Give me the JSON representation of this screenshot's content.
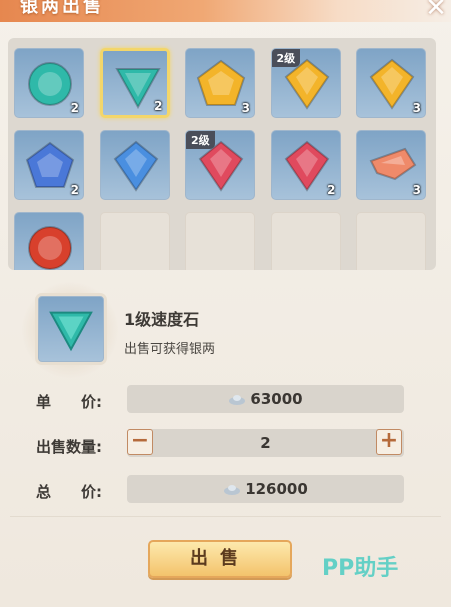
{
  "window": {
    "title": "银两出售",
    "close_icon": "close-icon"
  },
  "inventory": {
    "slots": [
      {
        "gem": "round-teal-gem",
        "color": "#2fb9a9",
        "count": "2",
        "level": ""
      },
      {
        "gem": "triangle-teal-gem",
        "color": "#2fb9a9",
        "count": "2",
        "level": "",
        "selected": true
      },
      {
        "gem": "pentagon-yellow-gem",
        "color": "#f3b42a",
        "count": "3",
        "level": ""
      },
      {
        "gem": "diamond-yellow-gem",
        "color": "#f3b42a",
        "count": "",
        "level": "2级"
      },
      {
        "gem": "diamond-yellow-gem",
        "color": "#f3b42a",
        "count": "3",
        "level": ""
      },
      {
        "gem": "pentagon-blue-gem",
        "color": "#4a78d8",
        "count": "2",
        "level": ""
      },
      {
        "gem": "diamond-blue-gem",
        "color": "#4a8fe0",
        "count": "",
        "level": ""
      },
      {
        "gem": "diamond-red-gem",
        "color": "#e04a5e",
        "count": "",
        "level": "2级"
      },
      {
        "gem": "diamond-red-gem",
        "color": "#e04a5e",
        "count": "2",
        "level": ""
      },
      {
        "gem": "shard-orange-gem",
        "color": "#ef8a6a",
        "count": "3",
        "level": ""
      },
      {
        "gem": "round-red-gem",
        "color": "#d8402c",
        "count": "",
        "level": ""
      }
    ],
    "empty_slots": 4
  },
  "detail": {
    "name": "1级速度石",
    "desc": "出售可获得银两"
  },
  "unit_price": {
    "label": "单　　价:",
    "value": "63000",
    "icon": "silver-ingot-icon"
  },
  "quantity": {
    "label": "出售数量:",
    "value": "2",
    "minus": "−",
    "plus": "+"
  },
  "total": {
    "label": "总　　价:",
    "value": "126000",
    "icon": "silver-ingot-icon"
  },
  "sell_button": "出售",
  "watermark": "PP助手"
}
